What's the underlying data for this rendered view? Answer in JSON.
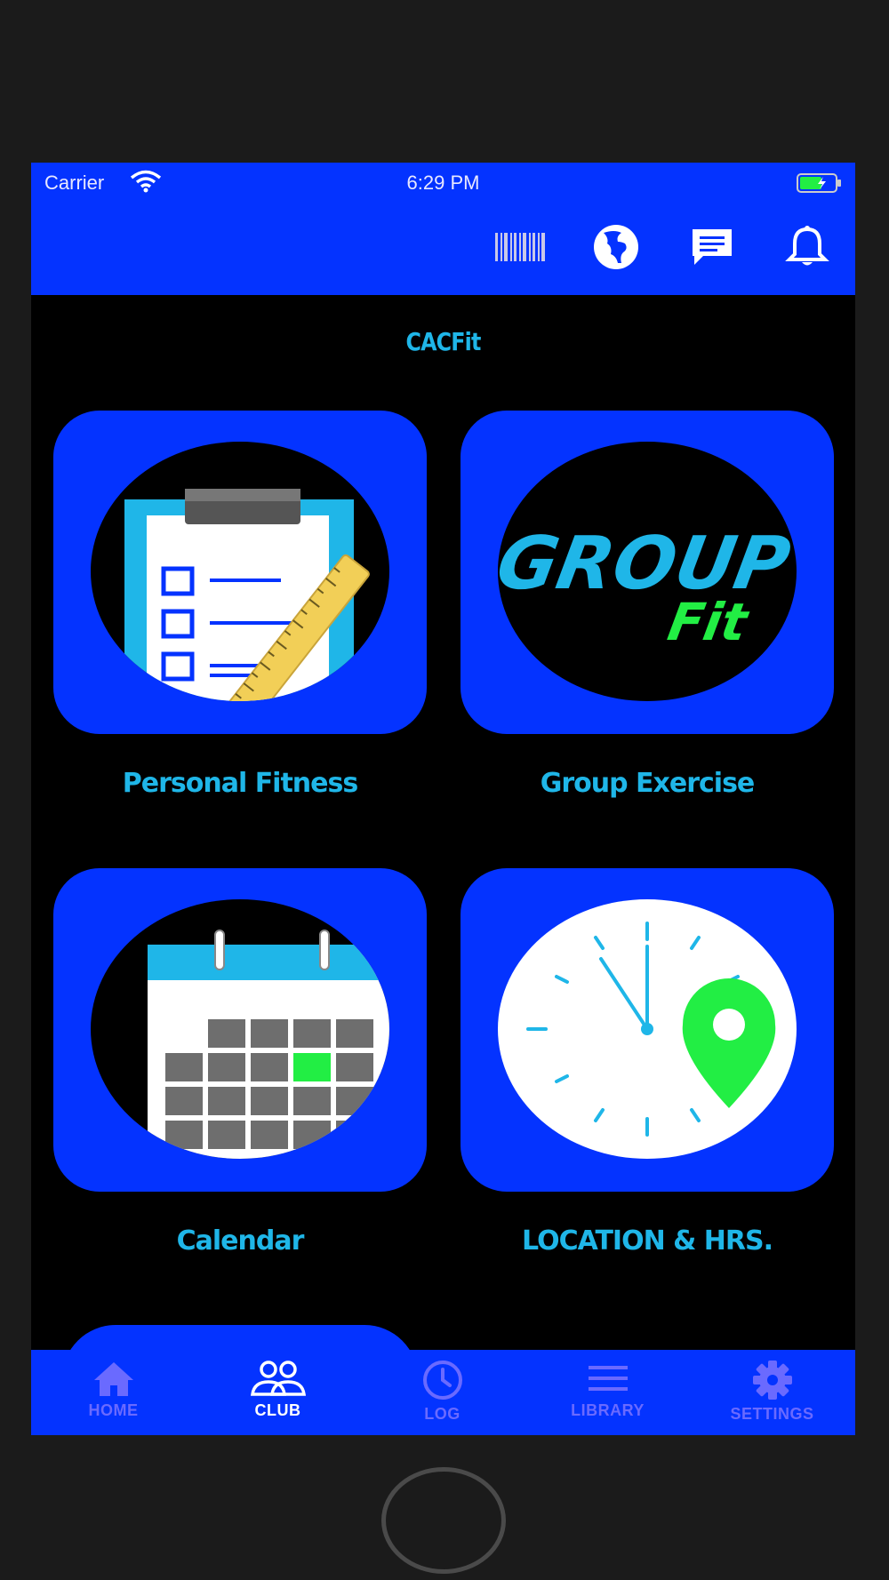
{
  "status_bar": {
    "carrier": "Carrier",
    "time": "6:29 PM"
  },
  "nav_icons": [
    "barcode-icon",
    "globe-icon",
    "message-icon",
    "bell-icon"
  ],
  "app_title": "CACFit",
  "tiles": [
    {
      "label": "Personal Fitness",
      "icon": "clipboard-ruler-icon"
    },
    {
      "label": "Group Exercise",
      "icon": "group-fit-logo",
      "logo_text": [
        "GROUP",
        "Fit"
      ]
    },
    {
      "label": "Calendar",
      "icon": "calendar-icon"
    },
    {
      "label": "LOCATION & HRS.",
      "icon": "clock-location-icon"
    }
  ],
  "tab_bar": {
    "tabs": [
      {
        "label": "HOME",
        "icon": "home-icon",
        "active": false
      },
      {
        "label": "CLUB",
        "icon": "people-icon",
        "active": true
      },
      {
        "label": "LOG",
        "icon": "clock-icon",
        "active": false
      },
      {
        "label": "LIBRARY",
        "icon": "menu-lines-icon",
        "active": false
      },
      {
        "label": "SETTINGS",
        "icon": "gear-icon",
        "active": false
      }
    ]
  },
  "colors": {
    "brand_blue": "#0433ff",
    "label_cyan": "#1fb6e8",
    "accent_green": "#22ee44",
    "tab_inactive": "#6a6aff"
  }
}
